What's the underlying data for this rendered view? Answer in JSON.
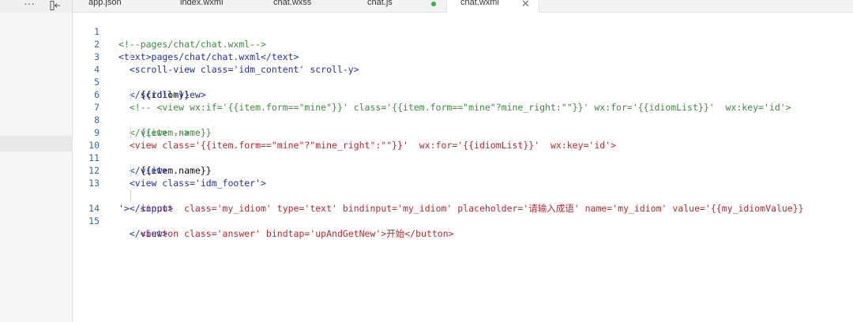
{
  "toolbar": {
    "more_icon": "ellipsis-icon",
    "collapse_icon": "collapse-panel-icon",
    "more_glyph": "···"
  },
  "tabs": [
    {
      "label": "app.json",
      "active": false
    },
    {
      "label": "index.wxml",
      "active": false
    },
    {
      "label": "chat.wxss",
      "active": false
    },
    {
      "label": "chat.js",
      "active": false,
      "modified": true
    },
    {
      "label": "chat.wxml",
      "active": true
    }
  ],
  "tab_close_glyph": "✕",
  "colors": {
    "modified_dot": "#2fb34a",
    "line_number": "#2b6cb0",
    "comment": "#3a8f3a",
    "attribute": "#c0262a",
    "value": "#1f2fbf"
  },
  "code": [
    {
      "n": "1",
      "text": "<!--pages/chat/chat.wxml-->"
    },
    {
      "n": "2",
      "text": "<text>pages/chat/chat.wxml</text>"
    },
    {
      "n": "3",
      "text": "  <scroll-view class='idm_content' scroll-y>"
    },
    {
      "n": "4",
      "text": "    {{idiom}}"
    },
    {
      "n": "5",
      "text": "  </scroll-view>"
    },
    {
      "n": "6",
      "text": "  <!-- <view wx:if='{{item.form==\"mine\"}}' class='{{item.form==\"mine\"?mine_right:\"\"}}' wx:for='{{idiomList}}'  wx:key='id'>"
    },
    {
      "n": "7",
      "text": "    {{item.name}}"
    },
    {
      "n": "8",
      "text": "  </view> -->"
    },
    {
      "n": "9",
      "text": "  <view class='{{item.form==\"mine\"?\"mine_right\":\"\"}}'  wx:for='{{idiomList}}'  wx:key='id'>"
    },
    {
      "n": "10",
      "text": "    {{item.name}}"
    },
    {
      "n": "11",
      "text": "  </view>"
    },
    {
      "n": "12",
      "text": "  <view class='idm_footer'>"
    },
    {
      "n": "13",
      "text": "    <input  class='my_idiom' type='text' bindinput='my_idiom' placeholder='请输入成语' name='my_idiom' value='{{my_idiomValue}}"
    },
    {
      "n": "",
      "text": "'></input>"
    },
    {
      "n": "14",
      "text": "    <button class='answer' bindtap='upAndGetNew'>开始</button>"
    },
    {
      "n": "15",
      "text": "  </view>"
    }
  ]
}
